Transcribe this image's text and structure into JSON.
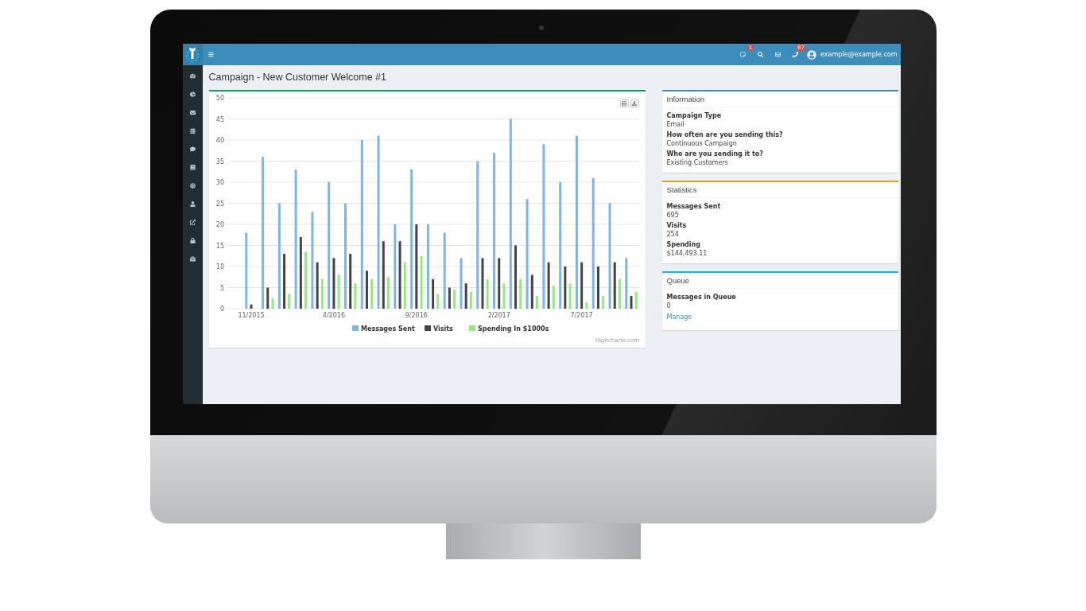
{
  "topbar": {
    "menu": {
      "kind": "menu"
    },
    "actions": [
      {
        "kind": "notes",
        "badge": "1"
      },
      {
        "kind": "search"
      },
      {
        "kind": "mail"
      },
      {
        "kind": "phone",
        "badge": "87"
      }
    ],
    "user": "example@example.com"
  },
  "sidebar": {
    "items": [
      {
        "kind": "dashboard"
      },
      {
        "kind": "pie"
      },
      {
        "kind": "mail"
      },
      {
        "kind": "calendar"
      },
      {
        "kind": "comment"
      },
      {
        "kind": "book"
      },
      {
        "kind": "globe"
      },
      {
        "kind": "user"
      },
      {
        "kind": "external"
      },
      {
        "kind": "lock"
      },
      {
        "kind": "briefcase"
      }
    ]
  },
  "page_title": "Campaign - New Customer Welcome #1",
  "chart": {
    "chart_data": {
      "type": "bar",
      "categories": [
        "11/2015",
        null,
        null,
        null,
        null,
        "4/2016",
        null,
        null,
        null,
        null,
        "9/2016",
        null,
        null,
        null,
        null,
        "2/2017",
        null,
        null,
        null,
        null,
        "7/2017",
        null,
        null,
        null
      ],
      "series": [
        {
          "name": "Messages Sent",
          "color": "#7cb5ec",
          "values": [
            18,
            36,
            25,
            33,
            23,
            30,
            25,
            40,
            41,
            20,
            33,
            20,
            18,
            12,
            35,
            37,
            45,
            26,
            39,
            30,
            41,
            31,
            25,
            12
          ]
        },
        {
          "name": "Visits",
          "color": "#434348",
          "values": [
            1,
            5,
            13,
            17,
            11,
            12,
            13,
            9,
            16,
            16,
            20,
            7,
            5,
            6,
            12,
            12,
            15,
            8,
            11,
            10,
            11,
            10,
            11,
            3
          ]
        },
        {
          "name": "Spending In $1000s",
          "color": "#90ed7d",
          "values": [
            0,
            2.5,
            3.5,
            13.5,
            7,
            8,
            6,
            7,
            7.5,
            11,
            12.5,
            3.5,
            4.5,
            4,
            7,
            6,
            7,
            3,
            5.5,
            6,
            1.5,
            3,
            7,
            4
          ]
        }
      ],
      "ylim": [
        0,
        50
      ],
      "yticks": [
        0,
        5,
        10,
        15,
        20,
        25,
        30,
        35,
        40,
        45,
        50
      ],
      "grid": true,
      "legend": "bottom"
    },
    "credit": "Highcharts.com"
  },
  "panels": [
    {
      "title": "Information",
      "color": "#3c8dbc",
      "fields": [
        {
          "label": "Campaign Type",
          "value": "Email"
        },
        {
          "label": "How often are you sending this?",
          "value": "Continuous Campaign"
        },
        {
          "label": "Who are you sending it to?",
          "value": "Existing Customers"
        }
      ]
    },
    {
      "title": "Statistics",
      "color": "#f39c12",
      "fields": [
        {
          "label": "Messages Sent",
          "value": "695"
        },
        {
          "label": "Visits",
          "value": "254"
        },
        {
          "label": "Spending",
          "value": "$144,493.11"
        }
      ]
    },
    {
      "title": "Queue",
      "color": "#00c0ef",
      "fields": [
        {
          "label": "Messages in Queue",
          "value": "0"
        }
      ],
      "link": "Manage"
    }
  ]
}
